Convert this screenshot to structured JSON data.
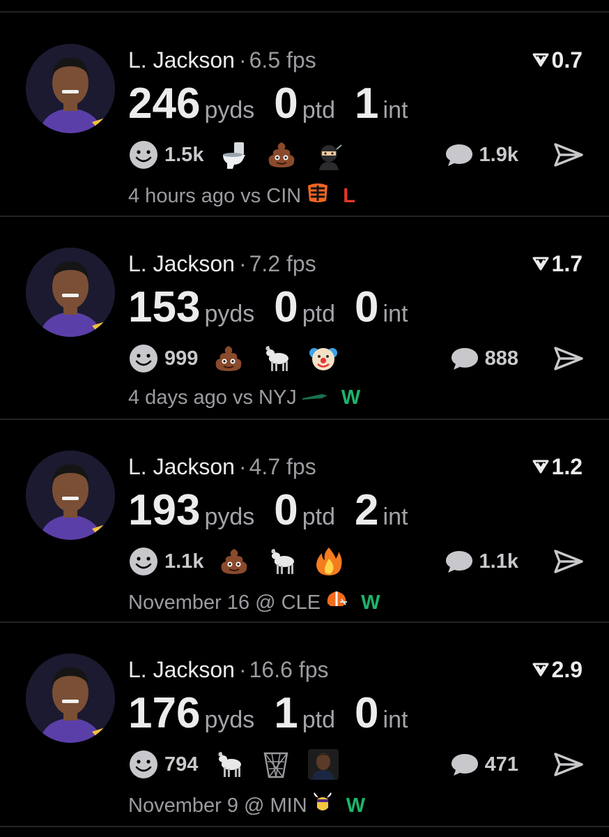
{
  "colors": {
    "loss": "#e8372c",
    "win": "#1db468",
    "background": "#000000"
  },
  "cards": [
    {
      "player": "L. Jackson",
      "separator": "·",
      "fps": "6.5 fps",
      "projection": "0.7",
      "pyds": "246",
      "pyds_unit": "pyds",
      "ptd": "0",
      "ptd_unit": "ptd",
      "int": "1",
      "int_unit": "int",
      "react_count": "1.5k",
      "reaction_icons": [
        "toilet-icon",
        "poop-icon",
        "ninja-icon"
      ],
      "comment_count": "1.9k",
      "time": "4 hours ago",
      "vs": "vs CIN",
      "team_logo": "bengals-logo-icon",
      "result": "L"
    },
    {
      "player": "L. Jackson",
      "separator": "·",
      "fps": "7.2 fps",
      "projection": "1.7",
      "pyds": "153",
      "pyds_unit": "pyds",
      "ptd": "0",
      "ptd_unit": "ptd",
      "int": "0",
      "int_unit": "int",
      "react_count": "999",
      "reaction_icons": [
        "poop-icon",
        "goat-icon",
        "clown-icon"
      ],
      "comment_count": "888",
      "time": "4 days ago",
      "vs": "vs NYJ",
      "team_logo": "jets-logo-icon",
      "result": "W"
    },
    {
      "player": "L. Jackson",
      "separator": "·",
      "fps": "4.7 fps",
      "projection": "1.2",
      "pyds": "193",
      "pyds_unit": "pyds",
      "ptd": "0",
      "ptd_unit": "ptd",
      "int": "2",
      "int_unit": "int",
      "react_count": "1.1k",
      "reaction_icons": [
        "poop-icon",
        "goat-icon",
        "fire-icon"
      ],
      "comment_count": "1.1k",
      "time": "November 16",
      "vs": "@ CLE",
      "team_logo": "browns-logo-icon",
      "result": "W"
    },
    {
      "player": "L. Jackson",
      "separator": "·",
      "fps": "16.6 fps",
      "projection": "2.9",
      "pyds": "176",
      "pyds_unit": "pyds",
      "ptd": "1",
      "ptd_unit": "ptd",
      "int": "0",
      "int_unit": "int",
      "react_count": "794",
      "reaction_icons": [
        "goat-icon",
        "basket-icon",
        "avatar-emoji-icon"
      ],
      "comment_count": "471",
      "time": "November 9",
      "vs": "@ MIN",
      "team_logo": "vikings-logo-icon",
      "result": "W"
    }
  ]
}
